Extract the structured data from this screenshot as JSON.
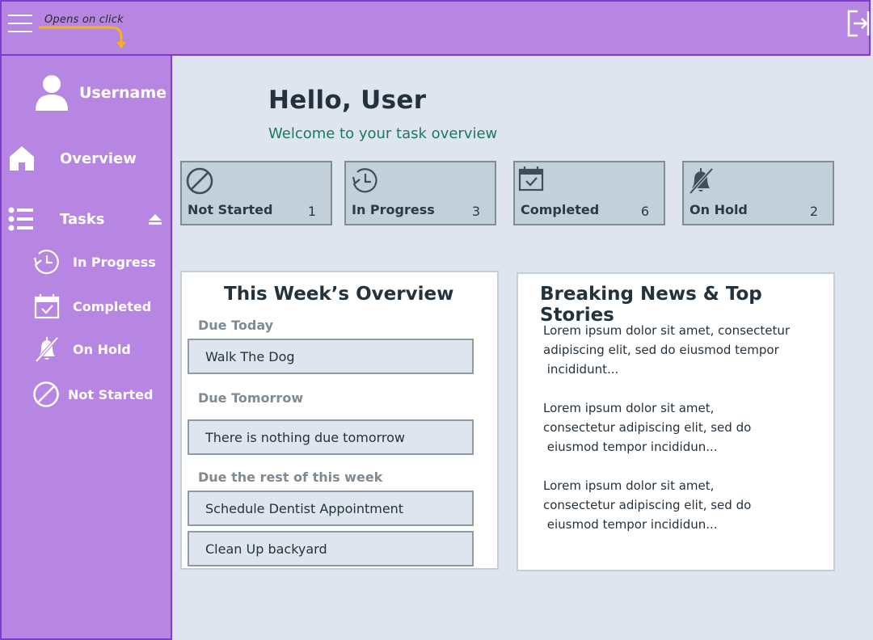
{
  "topbar": {
    "annotation": "Opens on click"
  },
  "sidebar": {
    "username": "Username",
    "overview_label": "Overview",
    "tasks_label": "Tasks",
    "subitems": [
      {
        "label": "In Progress",
        "icon": "clock-icon"
      },
      {
        "label": "Completed",
        "icon": "calendar-check-icon"
      },
      {
        "label": "On Hold",
        "icon": "bell-off-icon"
      },
      {
        "label": "Not Started",
        "icon": "ban-icon"
      }
    ]
  },
  "header": {
    "greeting": "Hello, User",
    "welcome": "Welcome to your task overview"
  },
  "stats": [
    {
      "label": "Not Started",
      "count": "1",
      "icon": "ban-icon"
    },
    {
      "label": "In Progress",
      "count": "3",
      "icon": "clock-icon"
    },
    {
      "label": "Completed",
      "count": "6",
      "icon": "calendar-check-icon"
    },
    {
      "label": "On Hold",
      "count": "2",
      "icon": "bell-off-icon"
    }
  ],
  "week": {
    "title": "This Week’s Overview",
    "due_today_label": "Due Today",
    "due_today": [
      "Walk The Dog"
    ],
    "due_tomorrow_label": "Due Tomorrow",
    "due_tomorrow": [
      "There is nothing due tomorrow"
    ],
    "due_rest_label": "Due the rest of this week",
    "due_rest": [
      "Schedule Dentist Appointment",
      "Clean Up backyard"
    ]
  },
  "news": {
    "title": "Breaking News & Top Stories",
    "items": [
      {
        "l1": "Lorem ipsum dolor sit amet, consectetur",
        "l2": "adipiscing elit, sed do eiusmod tempor",
        "l3": " incididunt..."
      },
      {
        "l1": "Lorem ipsum dolor sit amet,",
        "l2": "consectetur adipiscing elit, sed do",
        "l3": " eiusmod tempor incididun..."
      },
      {
        "l1": "Lorem ipsum dolor sit amet,",
        "l2": "consectetur adipiscing elit, sed do",
        "l3": " eiusmod tempor incididun..."
      }
    ]
  },
  "colors": {
    "sidebar_bg": "#b786e2",
    "border_accent": "#7a3dcf",
    "welcome_text": "#1b7a5e",
    "annotation_arrow": "#f5b121"
  }
}
